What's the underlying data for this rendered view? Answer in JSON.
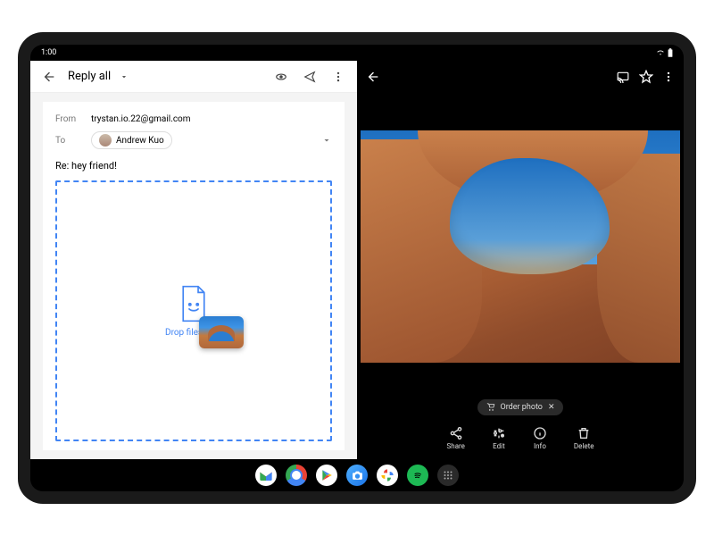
{
  "statusbar": {
    "time": "1:00"
  },
  "email": {
    "headerTitle": "Reply all",
    "fromLabel": "From",
    "fromAddress": "trystan.io.22@gmail.com",
    "toLabel": "To",
    "recipientName": "Andrew Kuo",
    "subject": "Re: hey friend!",
    "dropText": "Drop files here"
  },
  "photos": {
    "orderChip": "Order photo",
    "actions": {
      "share": "Share",
      "edit": "Edit",
      "info": "Info",
      "delete": "Delete"
    }
  }
}
